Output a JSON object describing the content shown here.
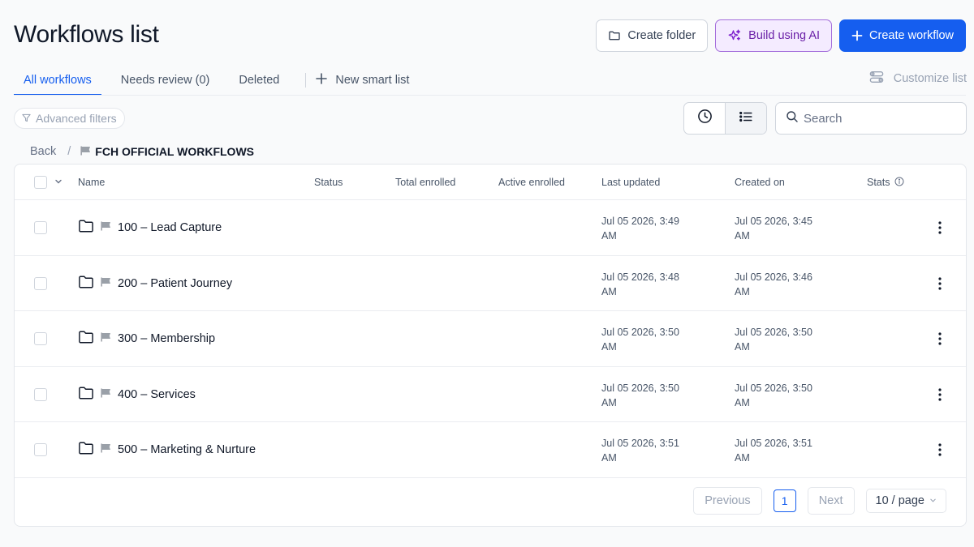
{
  "page": {
    "title": "Workflows list"
  },
  "actions": {
    "create_folder": "Create folder",
    "build_ai": "Build using AI",
    "create_workflow": "Create workflow"
  },
  "tabs": [
    {
      "label": "All workflows",
      "active": true
    },
    {
      "label": "Needs review (0)",
      "active": false
    },
    {
      "label": "Deleted",
      "active": false
    }
  ],
  "new_smart_list": "New smart list",
  "customize_list": "Customize list",
  "filters": {
    "advanced": "Advanced filters"
  },
  "search": {
    "placeholder": "Search",
    "value": ""
  },
  "breadcrumb": {
    "back": "Back",
    "separator": "/",
    "current": "FCH OFFICIAL WORKFLOWS"
  },
  "table": {
    "columns": {
      "name": "Name",
      "status": "Status",
      "total_enrolled": "Total enrolled",
      "active_enrolled": "Active enrolled",
      "last_updated": "Last updated",
      "created_on": "Created on",
      "stats": "Stats"
    },
    "rows": [
      {
        "name": "100 – Lead Capture",
        "updated_1": "Jul 05 2026, 3:49",
        "updated_2": "AM",
        "created_1": "Jul 05 2026, 3:45",
        "created_2": "AM"
      },
      {
        "name": "200 – Patient Journey",
        "updated_1": "Jul 05 2026, 3:48",
        "updated_2": "AM",
        "created_1": "Jul 05 2026, 3:46",
        "created_2": "AM"
      },
      {
        "name": "300 – Membership",
        "updated_1": "Jul 05 2026, 3:50",
        "updated_2": "AM",
        "created_1": "Jul 05 2026, 3:50",
        "created_2": "AM"
      },
      {
        "name": "400 – Services",
        "updated_1": "Jul 05 2026, 3:50",
        "updated_2": "AM",
        "created_1": "Jul 05 2026, 3:50",
        "created_2": "AM"
      },
      {
        "name": "500 – Marketing & Nurture",
        "updated_1": "Jul 05 2026, 3:51",
        "updated_2": "AM",
        "created_1": "Jul 05 2026, 3:51",
        "created_2": "AM"
      }
    ]
  },
  "pagination": {
    "previous": "Previous",
    "page": "1",
    "next": "Next",
    "page_size": "10 / page"
  },
  "colors": {
    "primary": "#155eef",
    "ai_border": "#a46edb",
    "ai_bg": "#f4ebff",
    "ai_text": "#6b21a8"
  }
}
